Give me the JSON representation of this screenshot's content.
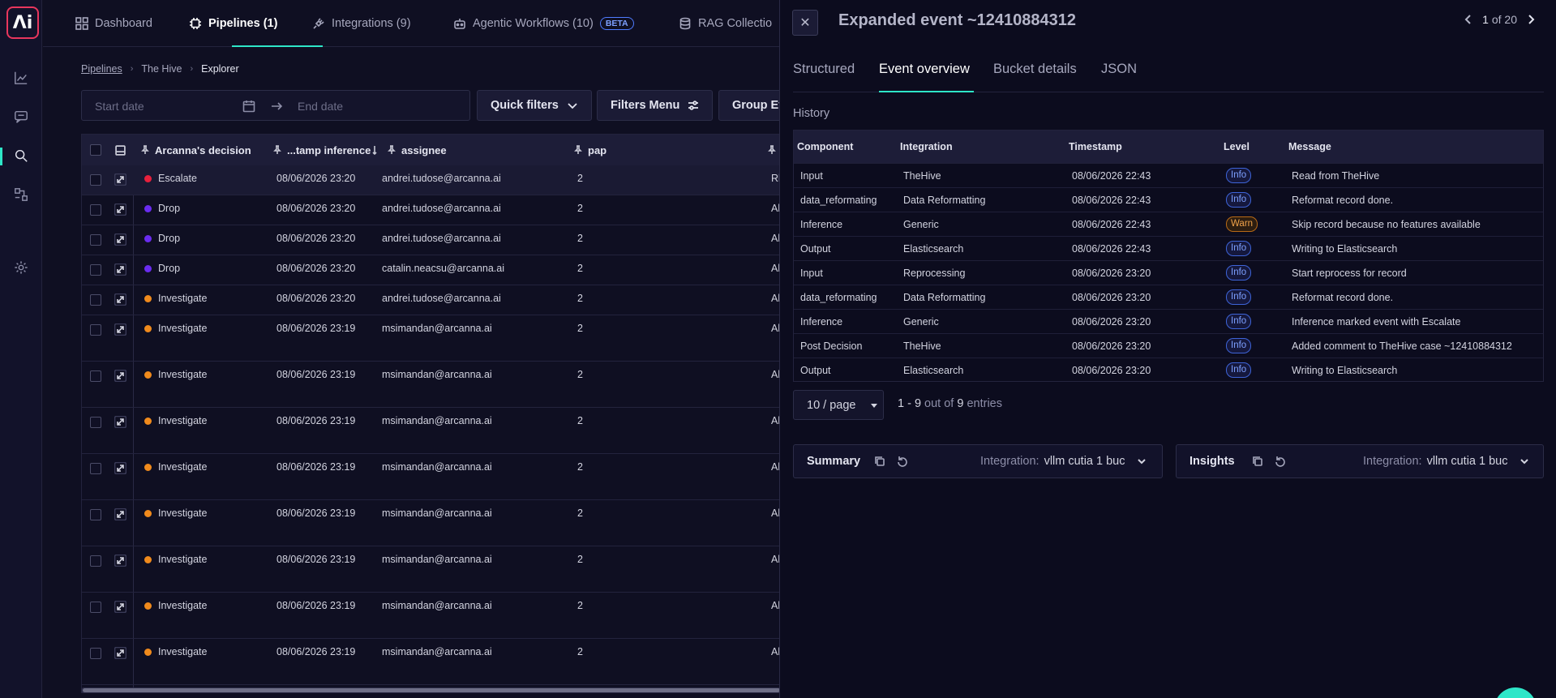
{
  "nav": {
    "items": [
      {
        "label": "Dashboard",
        "icon": "grid-icon"
      },
      {
        "label": "Pipelines (1)",
        "icon": "chip-icon"
      },
      {
        "label": "Integrations (9)",
        "icon": "plug-icon"
      },
      {
        "label": "Agentic Workflows (10)",
        "icon": "robot-icon",
        "badge": "BETA"
      },
      {
        "label": "RAG Collectio",
        "icon": "database-icon"
      }
    ]
  },
  "rail": {
    "logo": "Λi",
    "icons": [
      "chart-icon",
      "chat-icon",
      "search-icon",
      "workflow-icon",
      "gear-icon"
    ]
  },
  "breadcrumb": [
    "Pipelines",
    "The Hive",
    "Explorer"
  ],
  "filters": {
    "start_placeholder": "Start date",
    "end_placeholder": "End date",
    "quick_filters": "Quick filters",
    "filters_menu": "Filters Menu",
    "group": "Group Ev"
  },
  "table": {
    "headers": [
      "Arcanna's decision",
      "...tamp inference",
      "assignee",
      "pap"
    ],
    "rows": [
      {
        "decision": "Escalate",
        "color": "#e8203c",
        "time": "08/06/2026 23:20",
        "assignee": "andrei.tudose@arcanna.ai",
        "pap": "2",
        "extra": "Rl"
      },
      {
        "decision": "Drop",
        "color": "#6a2cf0",
        "time": "08/06/2026 23:20",
        "assignee": "andrei.tudose@arcanna.ai",
        "pap": "2",
        "extra": "Al"
      },
      {
        "decision": "Drop",
        "color": "#6a2cf0",
        "time": "08/06/2026 23:20",
        "assignee": "andrei.tudose@arcanna.ai",
        "pap": "2",
        "extra": "Al"
      },
      {
        "decision": "Drop",
        "color": "#6a2cf0",
        "time": "08/06/2026 23:20",
        "assignee": "catalin.neacsu@arcanna.ai",
        "pap": "2",
        "extra": "Al"
      },
      {
        "decision": "Investigate",
        "color": "#f08a1c",
        "time": "08/06/2026 23:20",
        "assignee": "andrei.tudose@arcanna.ai",
        "pap": "2",
        "extra": "Al"
      },
      {
        "decision": "Investigate",
        "color": "#f08a1c",
        "time": "08/06/2026 23:19",
        "assignee": "msimandan@arcanna.ai",
        "pap": "2",
        "extra": "Al"
      },
      {
        "decision": "Investigate",
        "color": "#f08a1c",
        "time": "08/06/2026 23:19",
        "assignee": "msimandan@arcanna.ai",
        "pap": "2",
        "extra": "Al"
      },
      {
        "decision": "Investigate",
        "color": "#f08a1c",
        "time": "08/06/2026 23:19",
        "assignee": "msimandan@arcanna.ai",
        "pap": "2",
        "extra": "Al"
      },
      {
        "decision": "Investigate",
        "color": "#f08a1c",
        "time": "08/06/2026 23:19",
        "assignee": "msimandan@arcanna.ai",
        "pap": "2",
        "extra": "Al"
      },
      {
        "decision": "Investigate",
        "color": "#f08a1c",
        "time": "08/06/2026 23:19",
        "assignee": "msimandan@arcanna.ai",
        "pap": "2",
        "extra": "Al"
      },
      {
        "decision": "Investigate",
        "color": "#f08a1c",
        "time": "08/06/2026 23:19",
        "assignee": "msimandan@arcanna.ai",
        "pap": "2",
        "extra": "Al"
      },
      {
        "decision": "Investigate",
        "color": "#f08a1c",
        "time": "08/06/2026 23:19",
        "assignee": "msimandan@arcanna.ai",
        "pap": "2",
        "extra": "Al"
      },
      {
        "decision": "Investigate",
        "color": "#f08a1c",
        "time": "08/06/2026 23:19",
        "assignee": "msimandan@arcanna.ai",
        "pap": "2",
        "extra": "Al"
      }
    ]
  },
  "panel": {
    "title": "Expanded event ~12410884312",
    "pager_current": "1",
    "pager_total": "of 20",
    "tabs": [
      "Structured",
      "Event overview",
      "Bucket details",
      "JSON"
    ],
    "history_label": "History",
    "history_headers": [
      "Component",
      "Integration",
      "Timestamp",
      "Level",
      "Message"
    ],
    "history": [
      {
        "component": "Input",
        "integration": "TheHive",
        "timestamp": "08/06/2026 22:43",
        "level": "Info",
        "message": "Read from TheHive"
      },
      {
        "component": "data_reformating",
        "integration": "Data Reformatting",
        "timestamp": "08/06/2026 22:43",
        "level": "Info",
        "message": "Reformat record done."
      },
      {
        "component": "Inference",
        "integration": "Generic",
        "timestamp": "08/06/2026 22:43",
        "level": "Warn",
        "message": "Skip record because no features available"
      },
      {
        "component": "Output",
        "integration": "Elasticsearch",
        "timestamp": "08/06/2026 22:43",
        "level": "Info",
        "message": "Writing to Elasticsearch"
      },
      {
        "component": "Input",
        "integration": "Reprocessing",
        "timestamp": "08/06/2026 23:20",
        "level": "Info",
        "message": "Start reprocess for record"
      },
      {
        "component": "data_reformating",
        "integration": "Data Reformatting",
        "timestamp": "08/06/2026 23:20",
        "level": "Info",
        "message": "Reformat record done."
      },
      {
        "component": "Inference",
        "integration": "Generic",
        "timestamp": "08/06/2026 23:20",
        "level": "Info",
        "message": "Inference marked event with Escalate"
      },
      {
        "component": "Post Decision",
        "integration": "TheHive",
        "timestamp": "08/06/2026 23:20",
        "level": "Info",
        "message": "Added comment to TheHive case ~12410884312"
      },
      {
        "component": "Output",
        "integration": "Elasticsearch",
        "timestamp": "08/06/2026 23:20",
        "level": "Info",
        "message": "Writing to Elasticsearch"
      }
    ],
    "per_page": "10 / page",
    "entries_range": "1 - 9",
    "entries_mid": "out of",
    "entries_total": "9",
    "entries_suffix": "entries",
    "summary": {
      "title": "Summary",
      "integration_label": "Integration:",
      "integration_value": "vllm cutia 1 buc"
    },
    "insights": {
      "title": "Insights",
      "integration_label": "Integration:",
      "integration_value": "vllm cutia 1 buc"
    }
  }
}
